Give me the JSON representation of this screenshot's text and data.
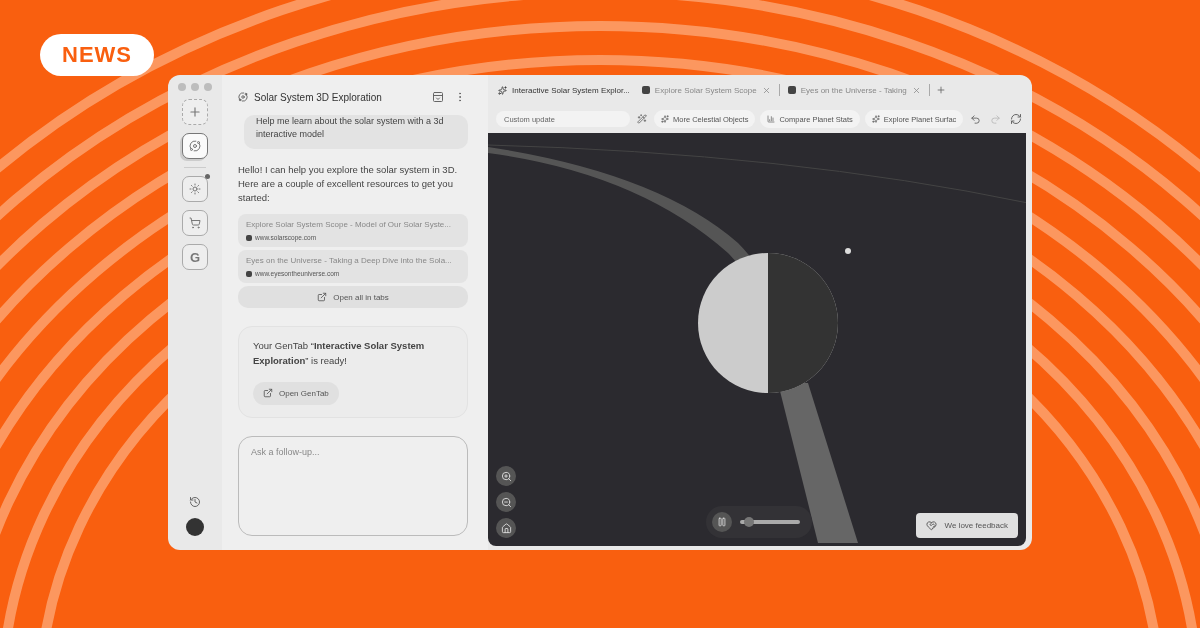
{
  "badge": "NEWS",
  "rail": {
    "items": [
      {
        "kind": "new",
        "selected": false
      },
      {
        "kind": "planet",
        "selected": true
      },
      {
        "kind": "sun",
        "selected": false,
        "notify": true
      },
      {
        "kind": "cart",
        "selected": false
      },
      {
        "kind": "letter",
        "label": "G",
        "selected": false
      }
    ]
  },
  "chat": {
    "title": "Solar System 3D Exploration",
    "user_message": "Help me learn about the solar system with a 3d interactive model",
    "reply": "Hello! I can help you explore the solar system in 3D. Here are a couple of excellent resources to get you started:",
    "links": [
      {
        "title": "Explore Solar System Scope - Model of Our Solar Syste...",
        "url": "www.solarscope.com"
      },
      {
        "title": "Eyes on the Universe - Taking a Deep Dive into the Sola...",
        "url": "www.eyesontheuniverse.com"
      }
    ],
    "open_all": "Open all in tabs",
    "gentab_message": "Your GenTab “**Interactive Solar System Exploration**” is ready!",
    "open_gentab": "Open GenTab",
    "input": {
      "placeholder": "Ask a follow-up..."
    }
  },
  "tabs": [
    {
      "label": "Interactive Solar System Explor...",
      "selected": true,
      "closable": false
    },
    {
      "label": "Explore Solar System Scope",
      "selected": false,
      "closable": true
    },
    {
      "label": "Eyes on the Universe - Taking",
      "selected": false,
      "closable": true
    }
  ],
  "toolbar": {
    "custom": {
      "placeholder": "Custom update"
    },
    "chips": [
      "More Celestial Objects",
      "Compare Planet Stats",
      "Explore Planet Surfac"
    ]
  },
  "viewer": {
    "playing": true,
    "level": 0.15,
    "feedback": "We love feedback"
  }
}
